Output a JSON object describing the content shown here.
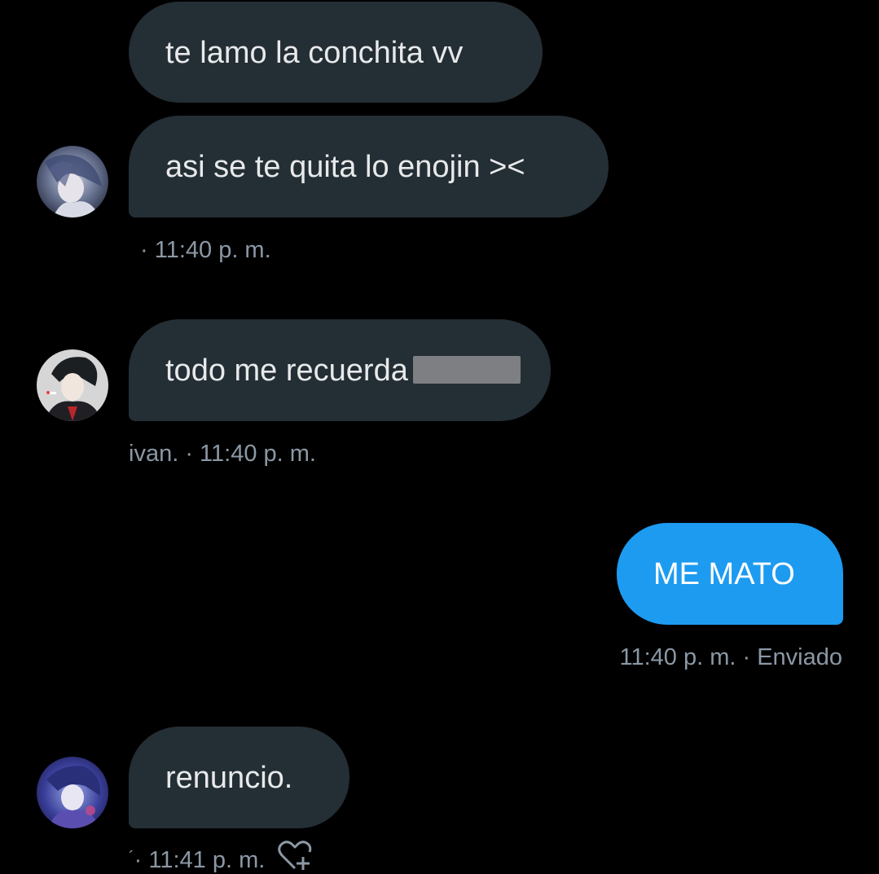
{
  "messages": [
    {
      "text": "te lamo la conchita vv",
      "direction": "received"
    },
    {
      "text": "asi se te quita lo enojin ><",
      "direction": "received",
      "meta": "· 11:40 p. m."
    },
    {
      "text": "todo me recuerda",
      "direction": "received",
      "redacted": true,
      "meta": "ivan. · 11:40 p. m."
    },
    {
      "text": "ME MATO",
      "direction": "sent",
      "meta": "11:40 p. m. · Enviado"
    },
    {
      "text": "renuncio.",
      "direction": "received",
      "meta_prefix": "´",
      "meta": "· 11:41 p. m."
    }
  ],
  "colors": {
    "background": "#000000",
    "received_bubble": "#242e35",
    "sent_bubble": "#1d9bf0",
    "meta_text": "#8b98a5"
  },
  "icons": {
    "reaction": "heart-plus-icon"
  }
}
